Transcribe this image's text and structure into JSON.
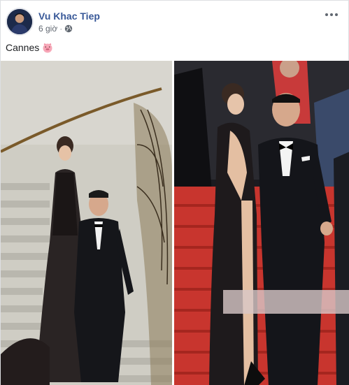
{
  "post": {
    "author": "Vu Khac Tiep",
    "time": "6 giờ",
    "separator": "·",
    "privacy_icon": "globe-icon",
    "more_icon": "more-dots-icon",
    "text": "Cannes",
    "emoji_icon": "pig-face-icon"
  },
  "photos": [
    {
      "name": "photo-staircase",
      "icon": "photo"
    },
    {
      "name": "photo-red-carpet",
      "icon": "photo"
    }
  ],
  "colors": {
    "author_link": "#385898",
    "meta": "#606770",
    "red_carpet": "#c8352e",
    "border": "#dddfe2"
  }
}
